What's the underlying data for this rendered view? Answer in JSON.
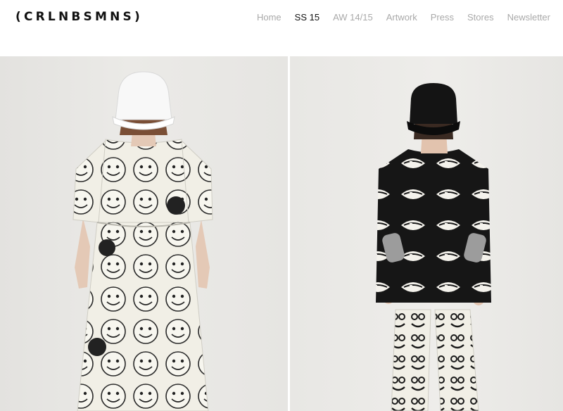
{
  "brand": {
    "logo": "(CRLNBSMNS)"
  },
  "nav": {
    "items": [
      {
        "label": "Home",
        "active": false
      },
      {
        "label": "SS 15",
        "active": true
      },
      {
        "label": "AW 14/15",
        "active": false
      },
      {
        "label": "Artwork",
        "active": false
      },
      {
        "label": "Press",
        "active": false
      },
      {
        "label": "Stores",
        "active": false
      },
      {
        "label": "Newsletter",
        "active": false
      }
    ]
  },
  "gallery": {
    "photos": [
      {
        "subject": "model in white cap and white smiley-print dress"
      },
      {
        "subject": "model in black cap, black lips-print sweater and smiley-print leggings"
      }
    ]
  },
  "colors": {
    "nav_inactive": "#a9a9a9",
    "nav_active": "#111111",
    "background": "#ffffff",
    "photo_backdrop": "#e8e7e4"
  }
}
